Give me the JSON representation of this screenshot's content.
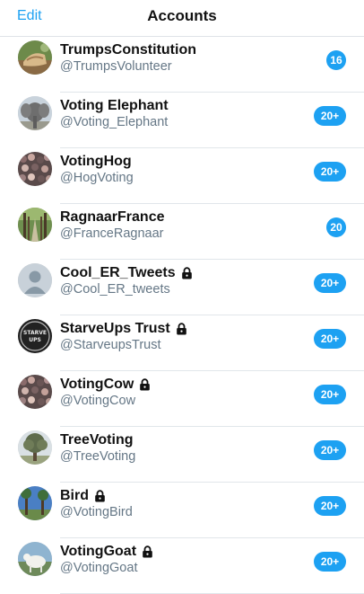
{
  "nav": {
    "edit_label": "Edit",
    "title": "Accounts"
  },
  "colors": {
    "accent": "#1da1f2",
    "handle": "#657786",
    "separator": "#e1e6ea"
  },
  "accounts": [
    {
      "name": "TrumpsConstitution",
      "handle": "@TrumpsVolunteer",
      "badge": "16",
      "locked": false,
      "avatar": "constitution-photo"
    },
    {
      "name": "Voting Elephant",
      "handle": "@Voting_Elephant",
      "badge": "20+",
      "locked": false,
      "avatar": "elephant-photo"
    },
    {
      "name": "VotingHog",
      "handle": "@HogVoting",
      "badge": "20+",
      "locked": false,
      "avatar": "crowd-photo"
    },
    {
      "name": "RagnaarFrance",
      "handle": "@FranceRagnaar",
      "badge": "20",
      "locked": false,
      "avatar": "tree-path-photo"
    },
    {
      "name": "Cool_ER_Tweets",
      "handle": "@Cool_ER_tweets",
      "badge": "20+",
      "locked": true,
      "avatar": "default-person"
    },
    {
      "name": "StarveUps Trust",
      "handle": "@StarveupsTrust",
      "badge": "20+",
      "locked": true,
      "avatar": "starve-ups-logo",
      "avatar_text": "STARVE UPS"
    },
    {
      "name": "VotingCow",
      "handle": "@VotingCow",
      "badge": "20+",
      "locked": true,
      "avatar": "crowd-photo"
    },
    {
      "name": "TreeVoting",
      "handle": "@TreeVoting",
      "badge": "20+",
      "locked": false,
      "avatar": "tree-photo"
    },
    {
      "name": "Bird",
      "handle": "@VotingBird",
      "badge": "20+",
      "locked": true,
      "avatar": "trees-sky-photo"
    },
    {
      "name": "VotingGoat",
      "handle": "@VotingGoat",
      "badge": "20+",
      "locked": true,
      "avatar": "goat-photo"
    }
  ]
}
